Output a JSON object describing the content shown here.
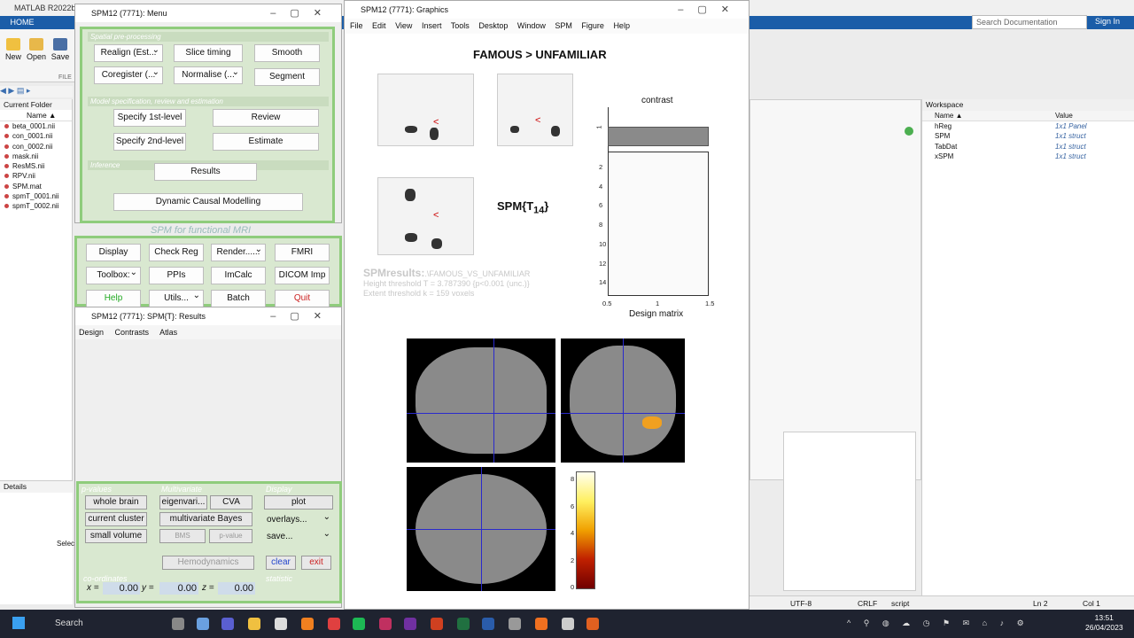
{
  "matlab": {
    "title": "MATLAB R2022b -",
    "home_tab": "HOME",
    "ribbon": {
      "new": "New",
      "open": "Open",
      "save": "Save",
      "file": "FILE"
    },
    "search_placeholder": "Search Documentation",
    "sign_in": "Sign In"
  },
  "current_folder": {
    "title": "Current Folder",
    "col_name": "Name ▲",
    "files": [
      "beta_0001.nii",
      "con_0001.nii",
      "con_0002.nii",
      "mask.nii",
      "ResMS.nii",
      "RPV.nii",
      "SPM.mat",
      "spmT_0001.nii",
      "spmT_0002.nii"
    ]
  },
  "details": {
    "title": "Details",
    "select": "Selec"
  },
  "workspace": {
    "title": "Workspace",
    "col_name": "Name ▲",
    "col_value": "Value",
    "rows": [
      {
        "name": "hReg",
        "value": "1x1 Panel"
      },
      {
        "name": "SPM",
        "value": "1x1 struct"
      },
      {
        "name": "TabDat",
        "value": "1x1 struct"
      },
      {
        "name": "xSPM",
        "value": "1x1 struct"
      }
    ]
  },
  "statusbar": {
    "encoding": "UTF-8",
    "eol": "CRLF",
    "type": "script",
    "ln": "Ln 2",
    "col": "Col 1"
  },
  "menu_window": {
    "title": "SPM12 (7771): Menu",
    "spatial": "Spatial pre-processing",
    "realign": "Realign (Est...",
    "slice_timing": "Slice timing",
    "smooth": "Smooth",
    "coregister": "Coregister (...",
    "normalise": "Normalise (...",
    "segment": "Segment",
    "model_spec": "Model specification, review and estimation",
    "specify1": "Specify 1st-level",
    "review": "Review",
    "specify2": "Specify 2nd-level",
    "estimate": "Estimate",
    "inference": "Inference",
    "results": "Results",
    "dcm": "Dynamic Causal Modelling",
    "fmri_title": "SPM for functional MRI",
    "display": "Display",
    "check_reg": "Check Reg",
    "render": "Render......",
    "fmri": "FMRI",
    "toolbox": "Toolbox:",
    "ppis": "PPIs",
    "imcalc": "ImCalc",
    "dicom": "DICOM Imp",
    "help": "Help",
    "utils": "Utils...",
    "batch": "Batch",
    "quit": "Quit"
  },
  "results_window": {
    "title": "SPM12 (7771): SPM{T}: Results",
    "menu": [
      "Design",
      "Contrasts",
      "Atlas"
    ],
    "p_values": "p-values",
    "whole_brain": "whole brain",
    "current_cluster": "current cluster",
    "small_volume": "small volume",
    "multivariate": "Multivariate",
    "eigenvari": "eigenvari...",
    "cva": "CVA",
    "multivariate_bayes": "multivariate Bayes",
    "bms": "BMS",
    "p_value": "p-value",
    "display": "Display",
    "plot": "plot",
    "overlays": "overlays...",
    "save": "save...",
    "hemodynamics": "Hemodynamics",
    "clear": "clear",
    "exit": "exit",
    "coordinates": "co-ordinates",
    "statistic": "statistic",
    "x_label": "x =",
    "y_label": "y =",
    "z_label": "z =",
    "x": "0.00",
    "y": "0.00",
    "z": "0.00"
  },
  "graphics_window": {
    "title": "SPM12 (7771): Graphics",
    "menu": [
      "File",
      "Edit",
      "View",
      "Insert",
      "Tools",
      "Desktop",
      "Window",
      "SPM Figure",
      "Help"
    ],
    "contrast_title": "FAMOUS > UNFAMILIAR",
    "spm_t": "SPM{T",
    "spm_t_sub": "14",
    "spm_t_close": "}",
    "sr_title": "SPMresults:",
    "sr_path": ".\\FAMOUS_VS_UNFAMILIAR",
    "height": "Height threshold T = 3.787390  {p<0.001 (unc.)}",
    "extent": "Extent threshold k = 159 voxels",
    "contrast_label": "contrast",
    "design_matrix": "Design matrix",
    "contrast_tick": "1",
    "y_ticks": [
      "2",
      "4",
      "6",
      "8",
      "10",
      "12",
      "14"
    ],
    "x_ticks": [
      "0.5",
      "1",
      "1.5"
    ],
    "cbar_ticks": [
      "8",
      "6",
      "4",
      "2",
      "0"
    ]
  },
  "taskbar": {
    "search": "Search",
    "time": "13:51",
    "date": "26/04/2023"
  }
}
